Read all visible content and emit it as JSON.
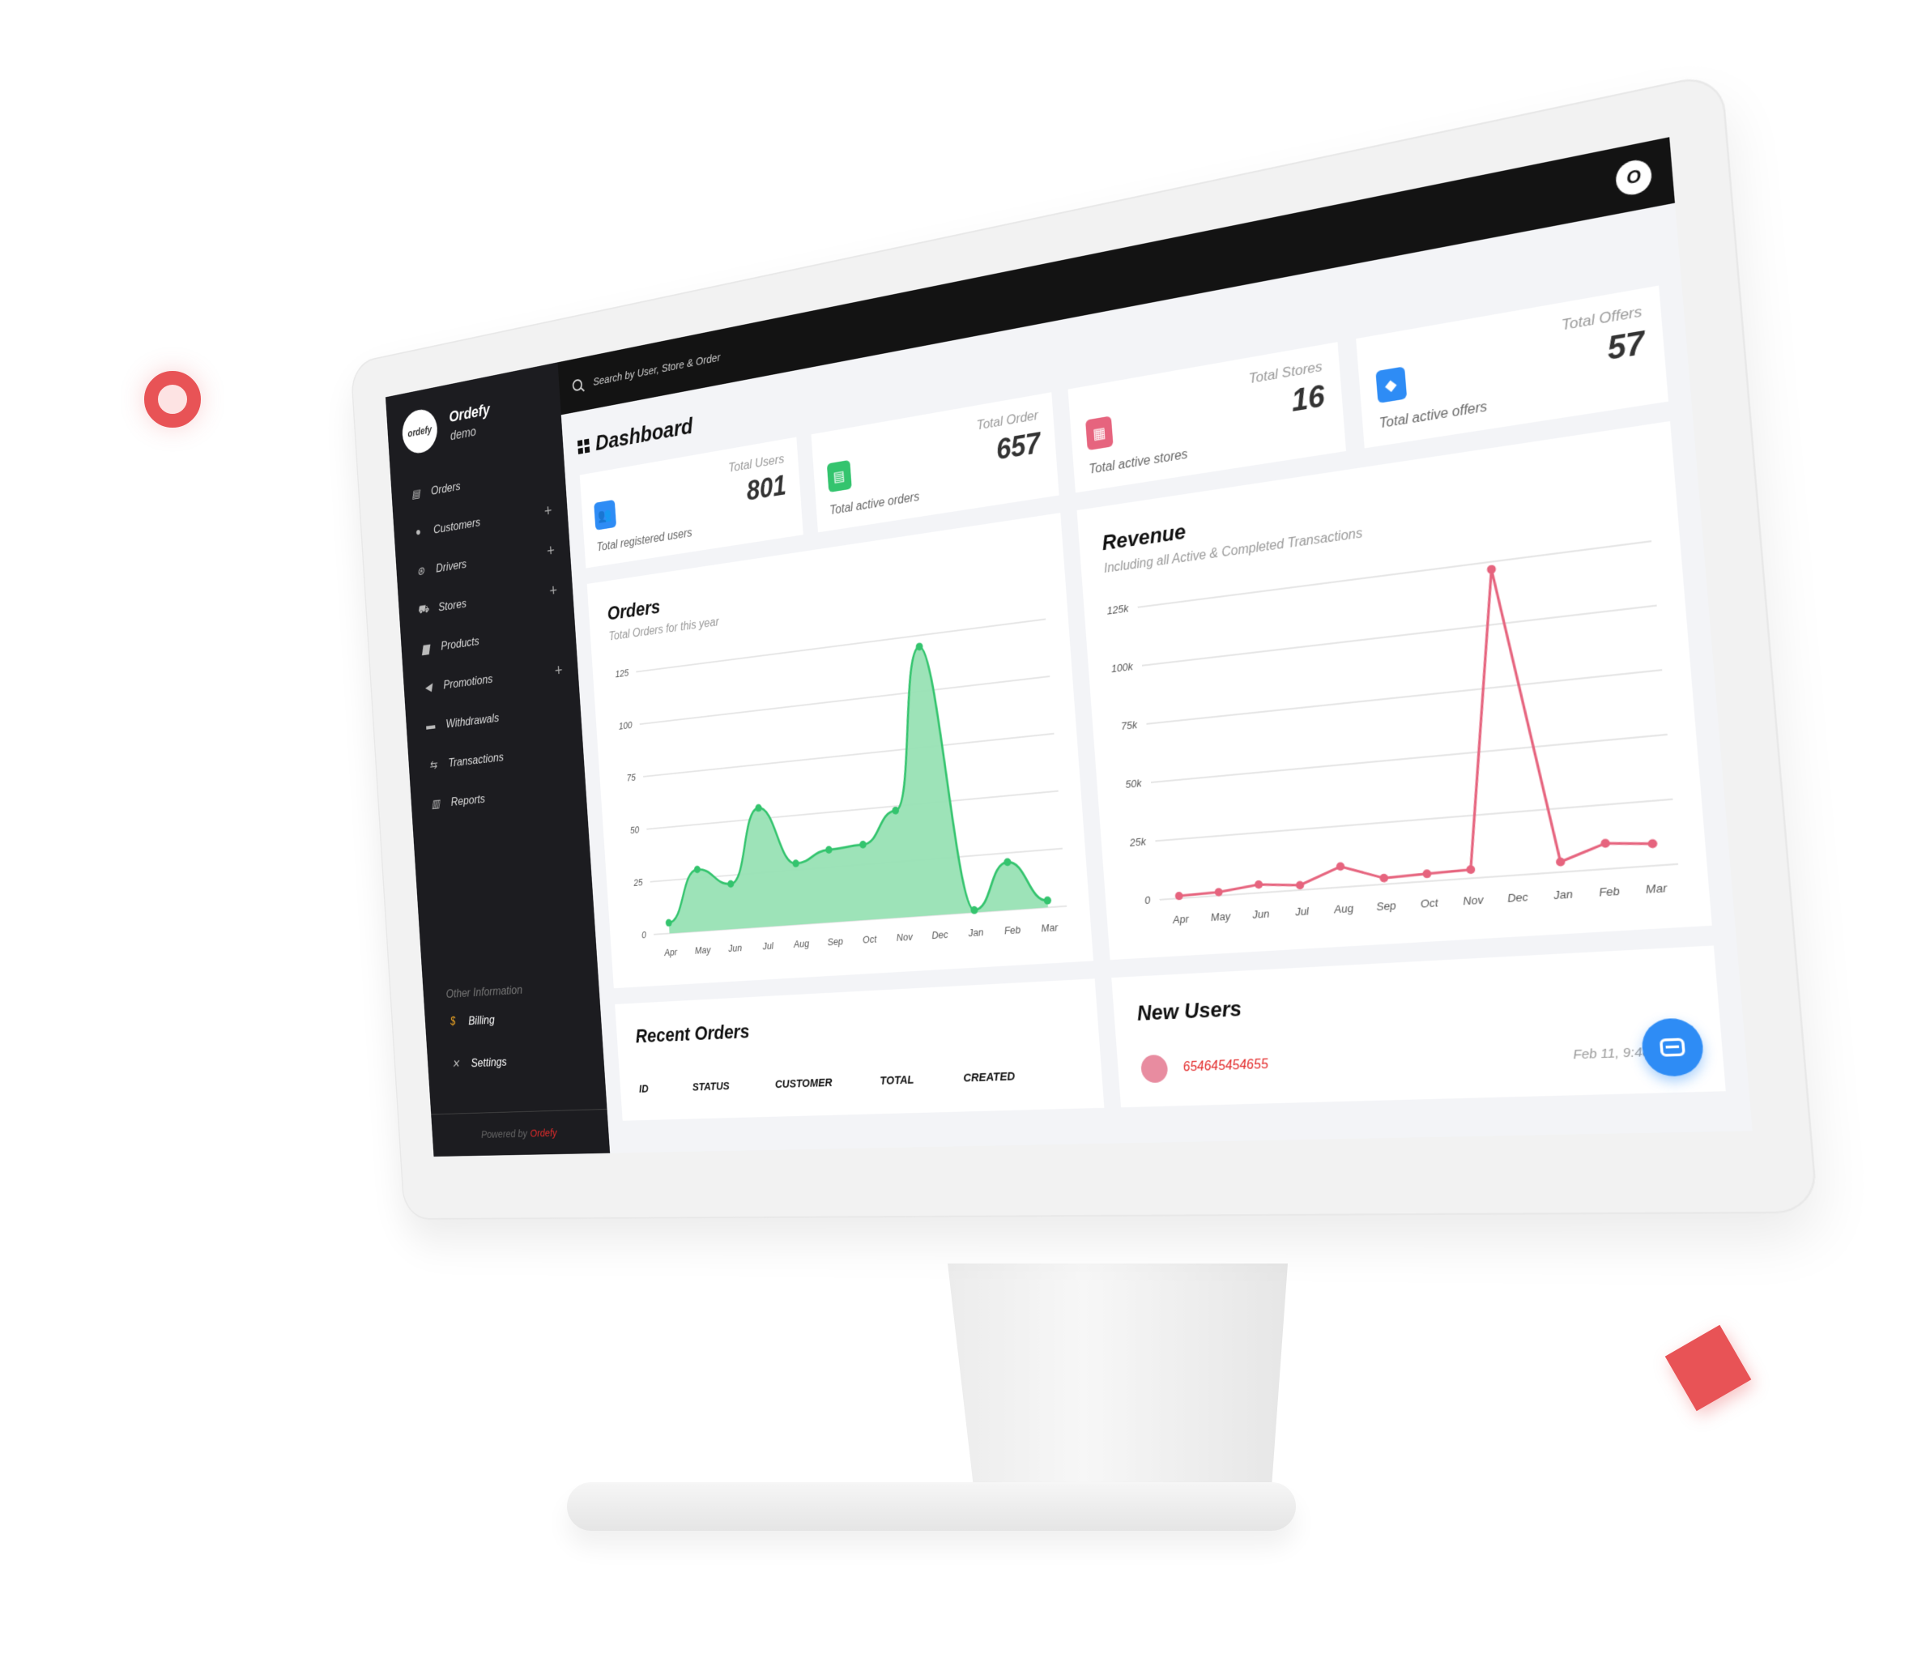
{
  "brand": {
    "name": "Ordefy",
    "subtitle": "demo",
    "logo_text": "ordefy"
  },
  "topbar": {
    "search_placeholder": "Search by User, Store & Order",
    "avatar_initial": "O"
  },
  "sidebar": {
    "items": [
      {
        "label": "Orders",
        "icon": "orders-icon",
        "expandable": false
      },
      {
        "label": "Customers",
        "icon": "customer-icon",
        "expandable": true
      },
      {
        "label": "Drivers",
        "icon": "steering-wheel-icon",
        "expandable": true
      },
      {
        "label": "Stores",
        "icon": "cart-icon",
        "expandable": true
      },
      {
        "label": "Products",
        "icon": "box-icon",
        "expandable": false
      },
      {
        "label": "Promotions",
        "icon": "megaphone-icon",
        "expandable": true
      },
      {
        "label": "Withdrawals",
        "icon": "wallet-icon",
        "expandable": false
      },
      {
        "label": "Transactions",
        "icon": "transfer-icon",
        "expandable": false
      },
      {
        "label": "Reports",
        "icon": "report-icon",
        "expandable": false
      }
    ],
    "other_title": "Other Information",
    "other_items": [
      {
        "label": "Billing",
        "icon": "money-bag-icon"
      },
      {
        "label": "Settings",
        "icon": "tools-icon"
      }
    ],
    "powered_by": "Powered by",
    "powered_brand": "Ordefy",
    "plus_symbol": "+"
  },
  "page": {
    "title": "Dashboard"
  },
  "stats": [
    {
      "label": "Total Users",
      "value": "801",
      "desc": "Total registered users",
      "color": "#2e8cf5",
      "icon": "users-icon",
      "glyph": "👥"
    },
    {
      "label": "Total Order",
      "value": "657",
      "desc": "Total active orders",
      "color": "#34c46e",
      "icon": "clipboard-icon",
      "glyph": "▤"
    },
    {
      "label": "Total Stores",
      "value": "16",
      "desc": "Total active stores",
      "color": "#e6647e",
      "icon": "store-icon",
      "glyph": "▦"
    },
    {
      "label": "Total Offers",
      "value": "57",
      "desc": "Total active offers",
      "color": "#2e8cf5",
      "icon": "tag-icon",
      "glyph": "◆"
    }
  ],
  "chart_data": [
    {
      "type": "area",
      "title": "Orders",
      "subtitle": "Total Orders for this year",
      "categories": [
        "Apr",
        "May",
        "Jun",
        "Jul",
        "Aug",
        "Sep",
        "Oct",
        "Nov",
        "Dec",
        "Jan",
        "Feb",
        "Mar"
      ],
      "values": [
        5,
        29,
        21,
        55,
        28,
        33,
        34,
        48,
        120,
        1,
        21,
        3
      ],
      "yticks": [
        "0",
        "25",
        "50",
        "75",
        "100",
        "125"
      ],
      "ylim": [
        0,
        125
      ],
      "color": "#34c46e",
      "fill": "#98e2b4",
      "grid": true
    },
    {
      "type": "line",
      "title": "Revenue",
      "subtitle": "Including all Active & Completed Transactions",
      "categories": [
        "Apr",
        "May",
        "Jun",
        "Jul",
        "Aug",
        "Sep",
        "Oct",
        "Nov",
        "Dec",
        "Jan",
        "Feb",
        "Mar"
      ],
      "values": [
        1000,
        1500,
        3500,
        2000,
        8500,
        2500,
        3000,
        3500,
        122000,
        4000,
        10000,
        8500
      ],
      "yticks": [
        "0",
        "25k",
        "50k",
        "75k",
        "100k",
        "125k"
      ],
      "ylim": [
        0,
        125000
      ],
      "color": "#e6647e",
      "grid": true
    }
  ],
  "recent_orders": {
    "title": "Recent Orders",
    "columns": [
      "ID",
      "STATUS",
      "CUSTOMER",
      "TOTAL",
      "CREATED"
    ]
  },
  "new_users": {
    "title": "New Users",
    "rows": [
      {
        "name": "654645454655",
        "date": "Feb 11, 9:48 AM"
      }
    ]
  }
}
